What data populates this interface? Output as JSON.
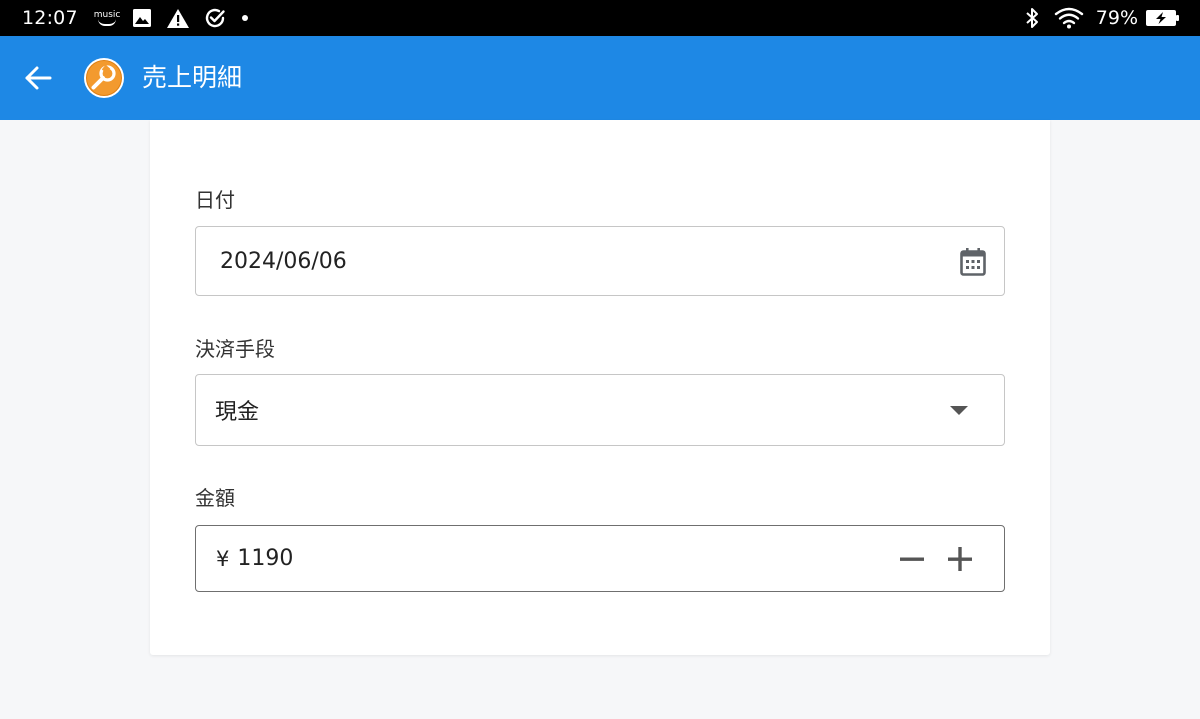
{
  "status_bar": {
    "time": "12:07",
    "music_label": "music",
    "battery_percent": "79%",
    "icons": [
      "amazon-music-icon",
      "image-icon",
      "warning-icon",
      "check-circle-icon",
      "notification-dot",
      "bluetooth-icon",
      "wifi-icon",
      "battery-charging-icon"
    ]
  },
  "app_bar": {
    "title": "売上明細",
    "back_icon": "arrow-left-icon",
    "logo_icon": "wrench-logo-icon",
    "color": "#1e88e5",
    "logo_color": "#f39a2e"
  },
  "form": {
    "date": {
      "label": "日付",
      "value": "2024/06/06",
      "icon": "calendar-icon"
    },
    "payment_method": {
      "label": "決済手段",
      "selected": "現金",
      "icon": "dropdown-arrow-icon"
    },
    "amount": {
      "label": "金額",
      "currency": "¥",
      "value": "1190",
      "decrement_icon": "minus-icon",
      "increment_icon": "plus-icon"
    }
  }
}
